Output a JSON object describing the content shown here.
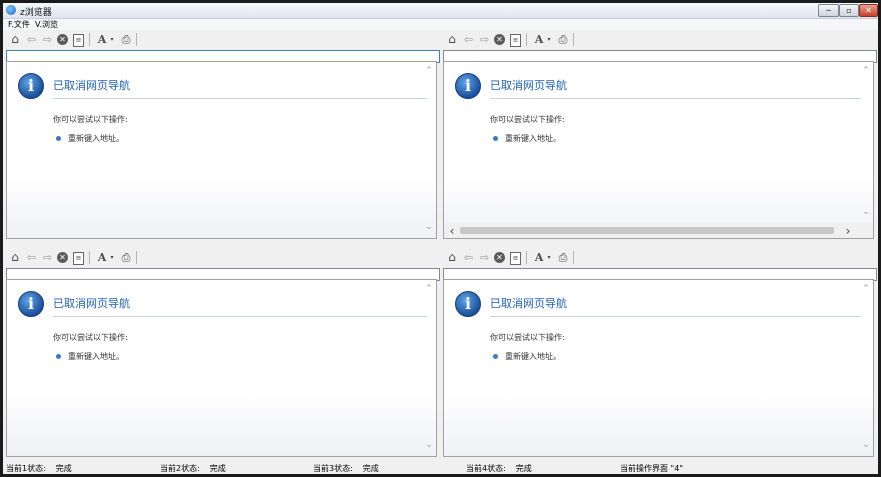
{
  "window": {
    "title": "z浏览器",
    "buttons": {
      "minimize": "─",
      "maximize": "▫",
      "close": "✕"
    }
  },
  "menu": [
    "F.文件",
    "V.浏览"
  ],
  "toolbar": {
    "icons": [
      "home-icon",
      "back-arrow-icon",
      "forward-arrow-icon",
      "stop-icon",
      "page-icon",
      "font-size-icon",
      "dropdown-icon",
      "print-icon"
    ],
    "glyphs": {
      "home": "⌂",
      "back": "⇦",
      "forward": "⇨",
      "stop": "✕",
      "page": "≡",
      "font": "A",
      "dropdown": "▾",
      "print": "⎙"
    }
  },
  "error_page": {
    "title": "已取消网页导航",
    "hint": "你可以尝试以下操作:",
    "suggestion": "重新键入地址。",
    "icon_letter": "i"
  },
  "panes": [
    {
      "id": 1,
      "address": ""
    },
    {
      "id": 2,
      "address": ""
    },
    {
      "id": 3,
      "address": ""
    },
    {
      "id": 4,
      "address": ""
    }
  ],
  "status": [
    {
      "label": "当前1状态:",
      "value": "完成"
    },
    {
      "label": "当前2状态:",
      "value": "完成"
    },
    {
      "label": "当前3状态:",
      "value": "完成"
    },
    {
      "label": "当前4状态:",
      "value": "完成"
    },
    {
      "label": "当前操作界面",
      "value": "\"4\""
    }
  ],
  "scroll": {
    "up": "⌃",
    "down": "⌄",
    "left": "‹",
    "right": "›"
  }
}
